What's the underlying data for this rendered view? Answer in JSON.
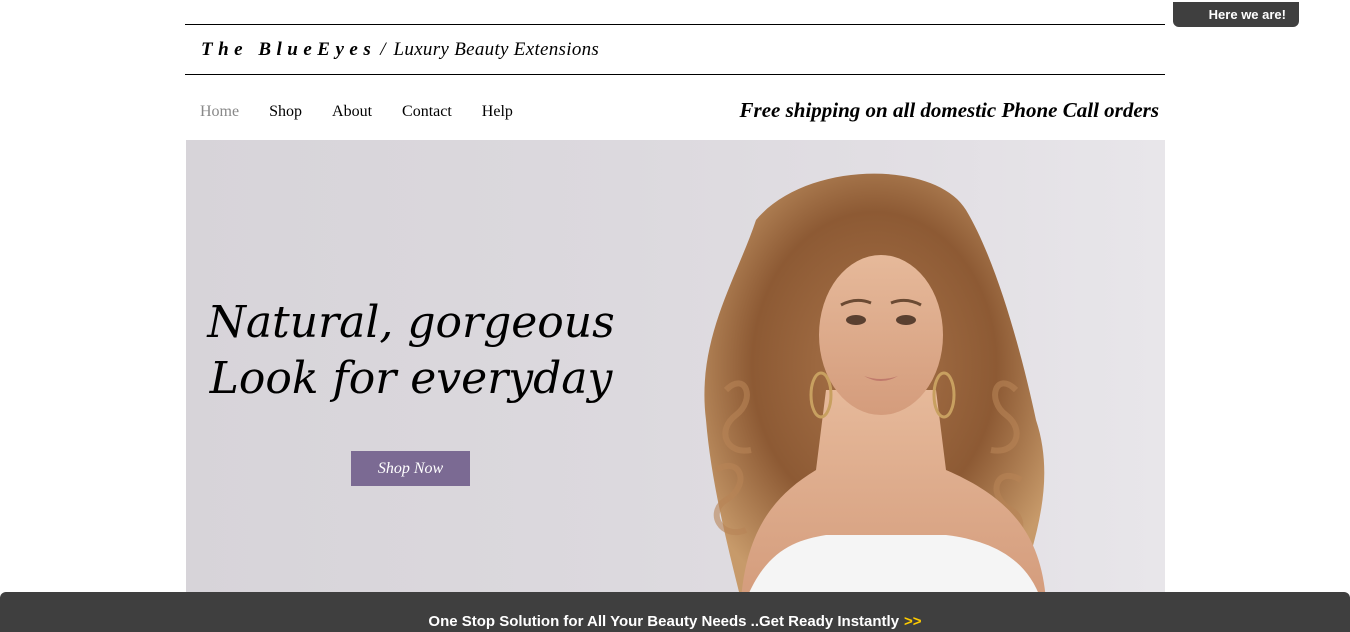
{
  "brand": {
    "name": "The BlueEyes",
    "separator": "/",
    "tagline": "Luxury Beauty Extensions"
  },
  "nav": {
    "items": [
      {
        "label": "Home",
        "active": true
      },
      {
        "label": "Shop"
      },
      {
        "label": "About"
      },
      {
        "label": "Contact"
      },
      {
        "label": "Help"
      }
    ]
  },
  "promo": {
    "text": "Free shipping on all domestic Phone Call orders"
  },
  "hero": {
    "headline_line1": "Natural, gorgeous",
    "headline_line2": "Look for everyday",
    "cta_label": "Shop Now",
    "background_color": "#dcd9de",
    "cta_color": "#7b6a93"
  },
  "here_tab": {
    "label": "Here we are!"
  },
  "bottom_bar": {
    "text": "One Stop Solution for All Your Beauty Needs ..Get Ready Instantly",
    "arrow": ">>",
    "arrow_color": "#ffcc00"
  }
}
